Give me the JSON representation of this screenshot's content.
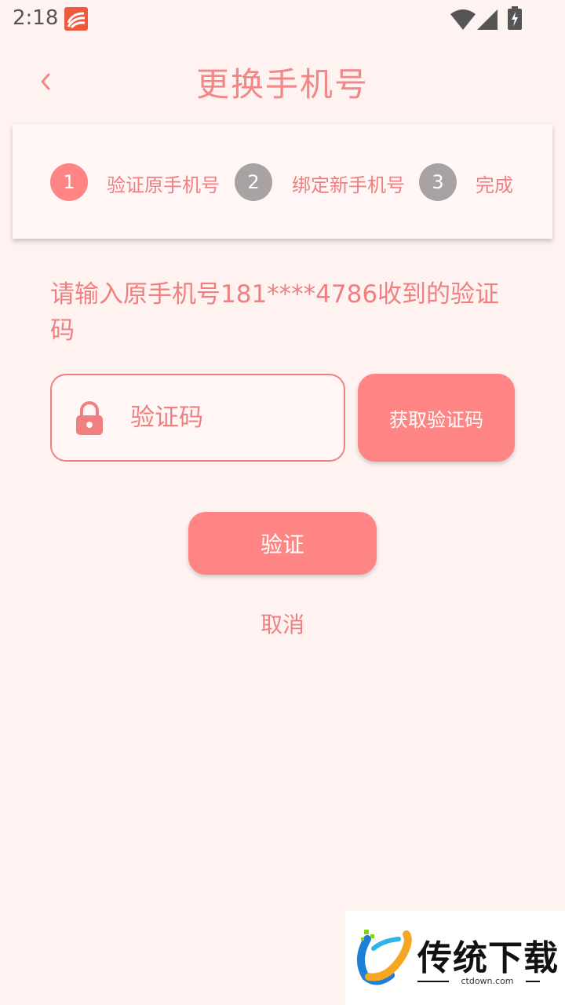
{
  "status_bar": {
    "time": "2:18"
  },
  "header": {
    "title": "更换手机号",
    "back_icon": "chevron-left-icon"
  },
  "steps": [
    {
      "number": "1",
      "label": "验证原手机号",
      "state": "active",
      "color": "#ff8585"
    },
    {
      "number": "2",
      "label": "绑定新手机号",
      "state": "inactive",
      "color": "#a8a2a2"
    },
    {
      "number": "3",
      "label": "完成",
      "state": "inactive",
      "color": "#a8a2a2"
    }
  ],
  "instruction": "请输入原手机号181****4786收到的验证码",
  "code_input": {
    "placeholder": "验证码",
    "value": "",
    "icon": "lock-icon"
  },
  "buttons": {
    "get_code": "获取验证码",
    "verify": "验证",
    "cancel": "取消"
  },
  "watermark": {
    "title": "传统下载",
    "site": "ctdown.com"
  },
  "colors": {
    "accent": "#ff8585",
    "text": "#f08080",
    "background": "#fff3f2",
    "inactive": "#a8a2a2"
  }
}
